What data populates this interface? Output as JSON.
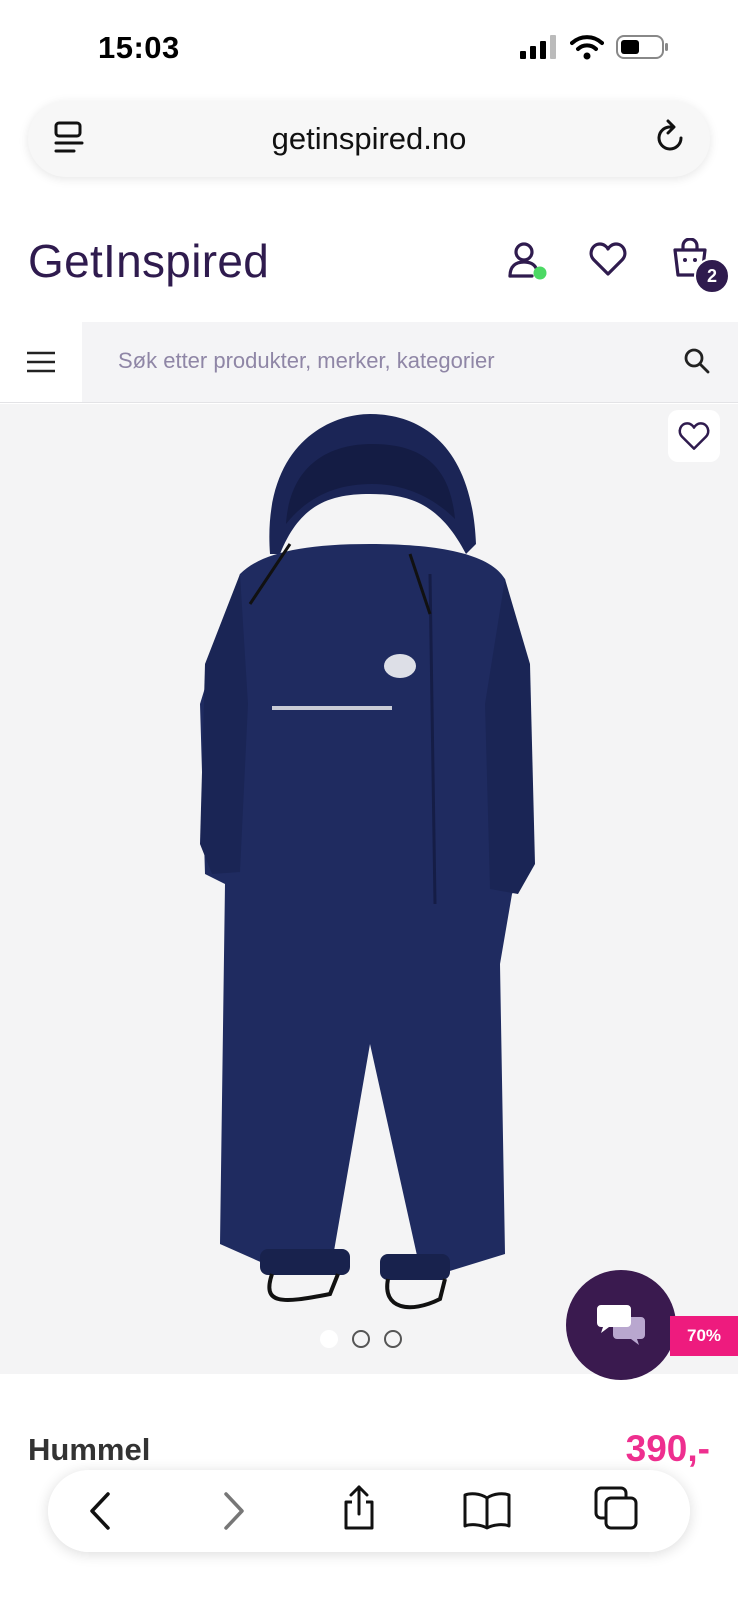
{
  "status_bar": {
    "time": "15:03"
  },
  "browser": {
    "url": "getinspired.no"
  },
  "header": {
    "logo": "GetInspired",
    "cart_count": "2"
  },
  "search": {
    "placeholder": "Søk etter produkter, merker, kategorier"
  },
  "product": {
    "brand": "Hummel",
    "price": "390,-",
    "discount_badge": "70%",
    "image_count": 3,
    "active_image_index": 0
  },
  "icons": [
    "reader-icon",
    "reload-icon",
    "account-icon",
    "heart-icon",
    "cart-icon",
    "menu-icon",
    "search-icon",
    "chat-icon",
    "back-icon",
    "forward-icon",
    "share-icon",
    "bookmarks-icon",
    "tabs-icon"
  ],
  "colors": {
    "brand": "#2f1b4e",
    "price": "#ee2f8f",
    "badge": "#ee1b7e",
    "chat": "#3a1a4f",
    "online": "#4cd964"
  }
}
